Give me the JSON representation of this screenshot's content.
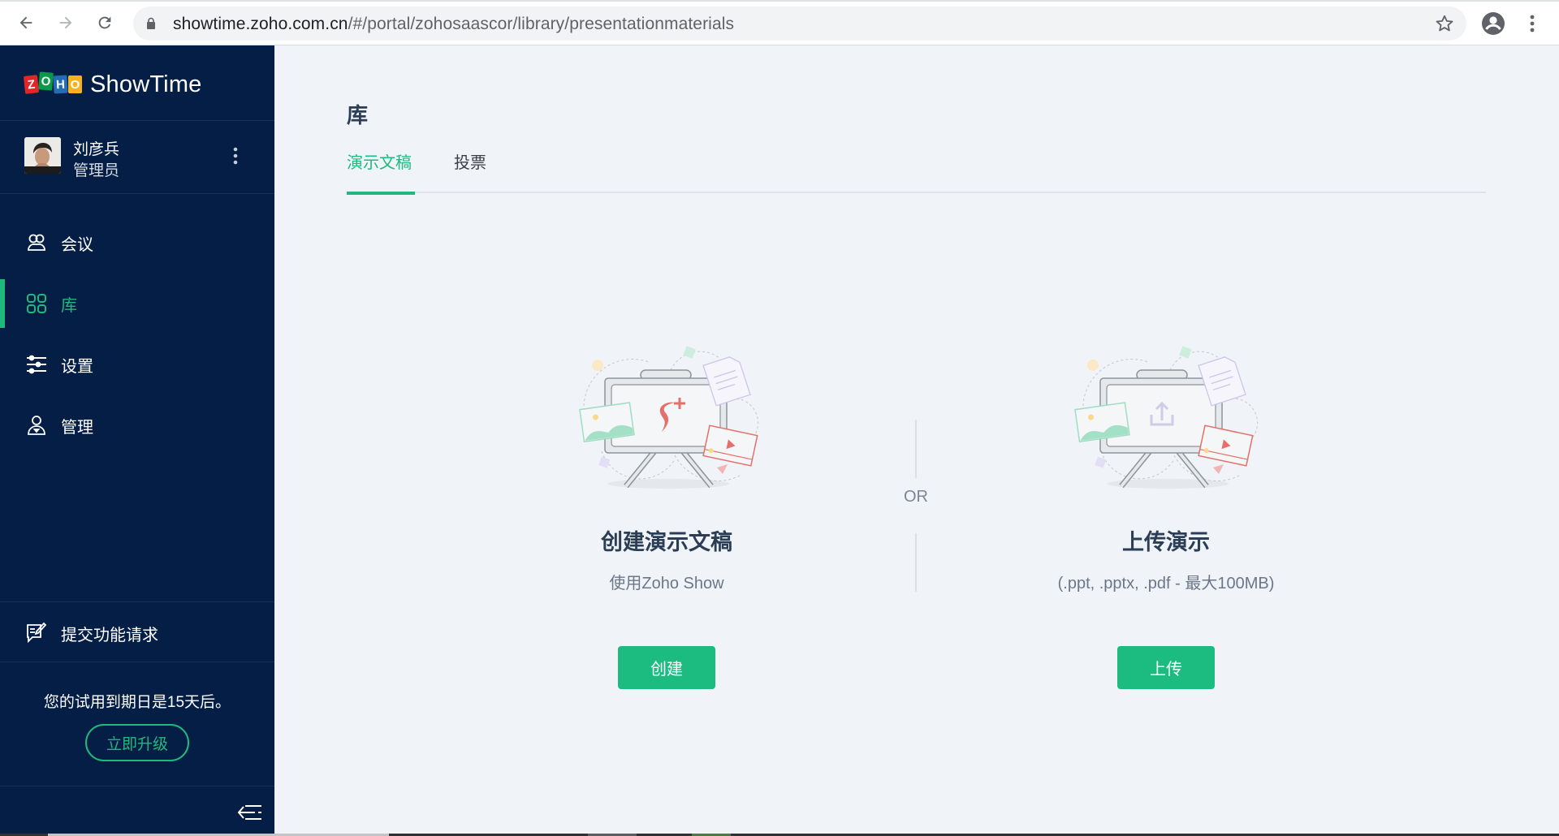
{
  "browser": {
    "back_icon": "arrow-left-icon",
    "forward_icon": "arrow-right-icon",
    "reload_icon": "reload-icon",
    "url_host": "showtime.zoho.com.cn",
    "url_path": "/#/portal/zohosaascor/library/presentationmaterials",
    "bookmark_icon": "star-outline-icon",
    "profile_icon": "account-circle-icon",
    "menu_icon": "vertical-dots-icon"
  },
  "sidebar": {
    "logo_letters": [
      "Z",
      "O",
      "H",
      "O"
    ],
    "brand": "ShowTime",
    "user": {
      "name": "刘彦兵",
      "role": "管理员"
    },
    "nav": [
      {
        "label": "会议",
        "icon": "meeting-people-icon",
        "active": false
      },
      {
        "label": "库",
        "icon": "grid-library-icon",
        "active": true
      },
      {
        "label": "设置",
        "icon": "sliders-settings-icon",
        "active": false
      },
      {
        "label": "管理",
        "icon": "admin-user-icon",
        "active": false
      }
    ],
    "feature_request": "提交功能请求",
    "trial_text": "您的试用到期日是15天后。",
    "upgrade_label": "立即升级",
    "collapse_icon": "collapse-sidebar-icon"
  },
  "main": {
    "title": "库",
    "tabs": [
      {
        "label": "演示文稿",
        "active": true
      },
      {
        "label": "投票",
        "active": false
      }
    ],
    "create_card": {
      "title": "创建演示文稿",
      "subtitle": "使用Zoho Show",
      "button": "创建"
    },
    "or_label": "OR",
    "upload_card": {
      "title": "上传演示",
      "subtitle": "(.ppt, .pptx, .pdf - 最大100MB)",
      "button": "上传"
    }
  },
  "colors": {
    "sidebar_bg": "#051e45",
    "accent_green": "#1fb97e",
    "button_green": "#1cbc80",
    "main_bg": "#f0f4f8",
    "heading_text": "#2c3e55"
  }
}
